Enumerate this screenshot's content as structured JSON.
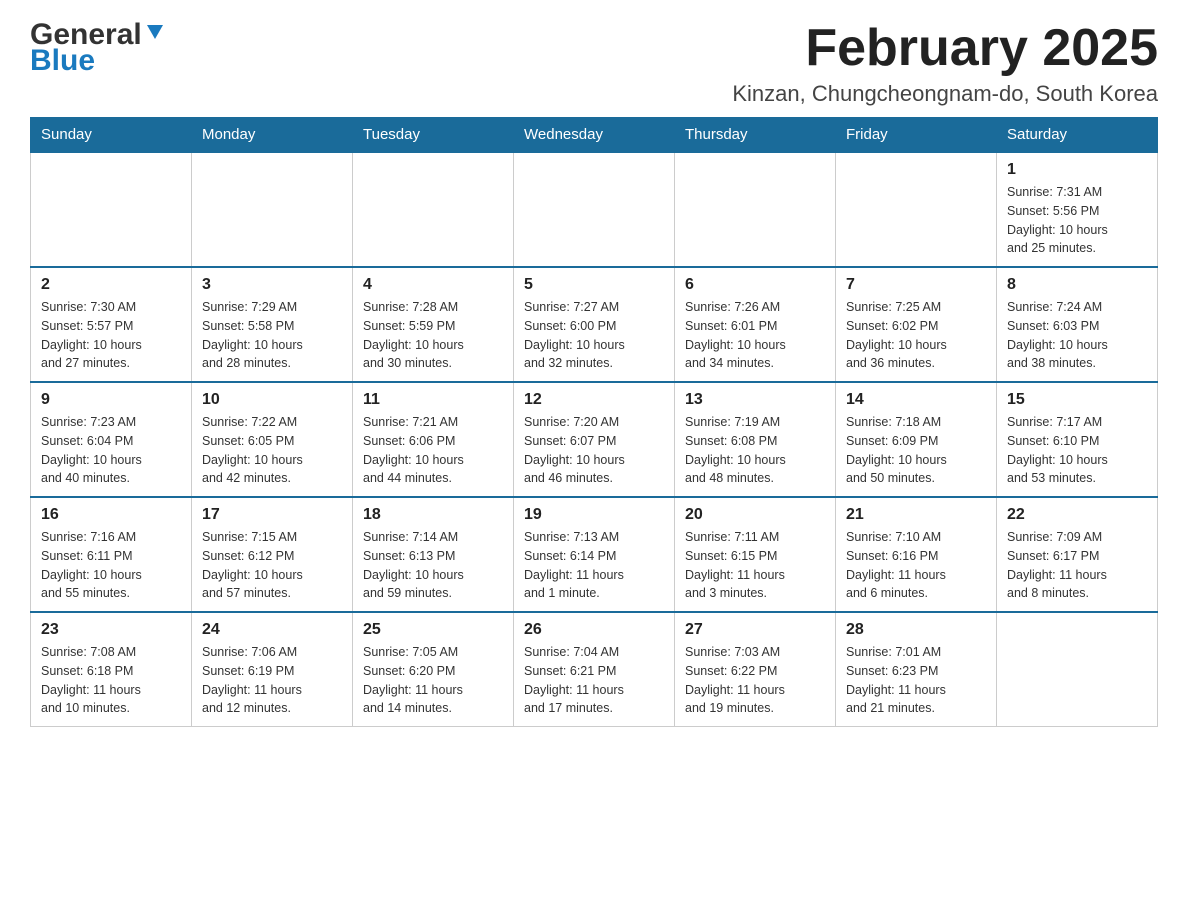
{
  "header": {
    "logo": {
      "general": "General",
      "blue": "Blue"
    },
    "title": "February 2025",
    "location": "Kinzan, Chungcheongnam-do, South Korea"
  },
  "days_of_week": [
    "Sunday",
    "Monday",
    "Tuesday",
    "Wednesday",
    "Thursday",
    "Friday",
    "Saturday"
  ],
  "weeks": [
    [
      {
        "day": "",
        "info": ""
      },
      {
        "day": "",
        "info": ""
      },
      {
        "day": "",
        "info": ""
      },
      {
        "day": "",
        "info": ""
      },
      {
        "day": "",
        "info": ""
      },
      {
        "day": "",
        "info": ""
      },
      {
        "day": "1",
        "info": "Sunrise: 7:31 AM\nSunset: 5:56 PM\nDaylight: 10 hours\nand 25 minutes."
      }
    ],
    [
      {
        "day": "2",
        "info": "Sunrise: 7:30 AM\nSunset: 5:57 PM\nDaylight: 10 hours\nand 27 minutes."
      },
      {
        "day": "3",
        "info": "Sunrise: 7:29 AM\nSunset: 5:58 PM\nDaylight: 10 hours\nand 28 minutes."
      },
      {
        "day": "4",
        "info": "Sunrise: 7:28 AM\nSunset: 5:59 PM\nDaylight: 10 hours\nand 30 minutes."
      },
      {
        "day": "5",
        "info": "Sunrise: 7:27 AM\nSunset: 6:00 PM\nDaylight: 10 hours\nand 32 minutes."
      },
      {
        "day": "6",
        "info": "Sunrise: 7:26 AM\nSunset: 6:01 PM\nDaylight: 10 hours\nand 34 minutes."
      },
      {
        "day": "7",
        "info": "Sunrise: 7:25 AM\nSunset: 6:02 PM\nDaylight: 10 hours\nand 36 minutes."
      },
      {
        "day": "8",
        "info": "Sunrise: 7:24 AM\nSunset: 6:03 PM\nDaylight: 10 hours\nand 38 minutes."
      }
    ],
    [
      {
        "day": "9",
        "info": "Sunrise: 7:23 AM\nSunset: 6:04 PM\nDaylight: 10 hours\nand 40 minutes."
      },
      {
        "day": "10",
        "info": "Sunrise: 7:22 AM\nSunset: 6:05 PM\nDaylight: 10 hours\nand 42 minutes."
      },
      {
        "day": "11",
        "info": "Sunrise: 7:21 AM\nSunset: 6:06 PM\nDaylight: 10 hours\nand 44 minutes."
      },
      {
        "day": "12",
        "info": "Sunrise: 7:20 AM\nSunset: 6:07 PM\nDaylight: 10 hours\nand 46 minutes."
      },
      {
        "day": "13",
        "info": "Sunrise: 7:19 AM\nSunset: 6:08 PM\nDaylight: 10 hours\nand 48 minutes."
      },
      {
        "day": "14",
        "info": "Sunrise: 7:18 AM\nSunset: 6:09 PM\nDaylight: 10 hours\nand 50 minutes."
      },
      {
        "day": "15",
        "info": "Sunrise: 7:17 AM\nSunset: 6:10 PM\nDaylight: 10 hours\nand 53 minutes."
      }
    ],
    [
      {
        "day": "16",
        "info": "Sunrise: 7:16 AM\nSunset: 6:11 PM\nDaylight: 10 hours\nand 55 minutes."
      },
      {
        "day": "17",
        "info": "Sunrise: 7:15 AM\nSunset: 6:12 PM\nDaylight: 10 hours\nand 57 minutes."
      },
      {
        "day": "18",
        "info": "Sunrise: 7:14 AM\nSunset: 6:13 PM\nDaylight: 10 hours\nand 59 minutes."
      },
      {
        "day": "19",
        "info": "Sunrise: 7:13 AM\nSunset: 6:14 PM\nDaylight: 11 hours\nand 1 minute."
      },
      {
        "day": "20",
        "info": "Sunrise: 7:11 AM\nSunset: 6:15 PM\nDaylight: 11 hours\nand 3 minutes."
      },
      {
        "day": "21",
        "info": "Sunrise: 7:10 AM\nSunset: 6:16 PM\nDaylight: 11 hours\nand 6 minutes."
      },
      {
        "day": "22",
        "info": "Sunrise: 7:09 AM\nSunset: 6:17 PM\nDaylight: 11 hours\nand 8 minutes."
      }
    ],
    [
      {
        "day": "23",
        "info": "Sunrise: 7:08 AM\nSunset: 6:18 PM\nDaylight: 11 hours\nand 10 minutes."
      },
      {
        "day": "24",
        "info": "Sunrise: 7:06 AM\nSunset: 6:19 PM\nDaylight: 11 hours\nand 12 minutes."
      },
      {
        "day": "25",
        "info": "Sunrise: 7:05 AM\nSunset: 6:20 PM\nDaylight: 11 hours\nand 14 minutes."
      },
      {
        "day": "26",
        "info": "Sunrise: 7:04 AM\nSunset: 6:21 PM\nDaylight: 11 hours\nand 17 minutes."
      },
      {
        "day": "27",
        "info": "Sunrise: 7:03 AM\nSunset: 6:22 PM\nDaylight: 11 hours\nand 19 minutes."
      },
      {
        "day": "28",
        "info": "Sunrise: 7:01 AM\nSunset: 6:23 PM\nDaylight: 11 hours\nand 21 minutes."
      },
      {
        "day": "",
        "info": ""
      }
    ]
  ]
}
